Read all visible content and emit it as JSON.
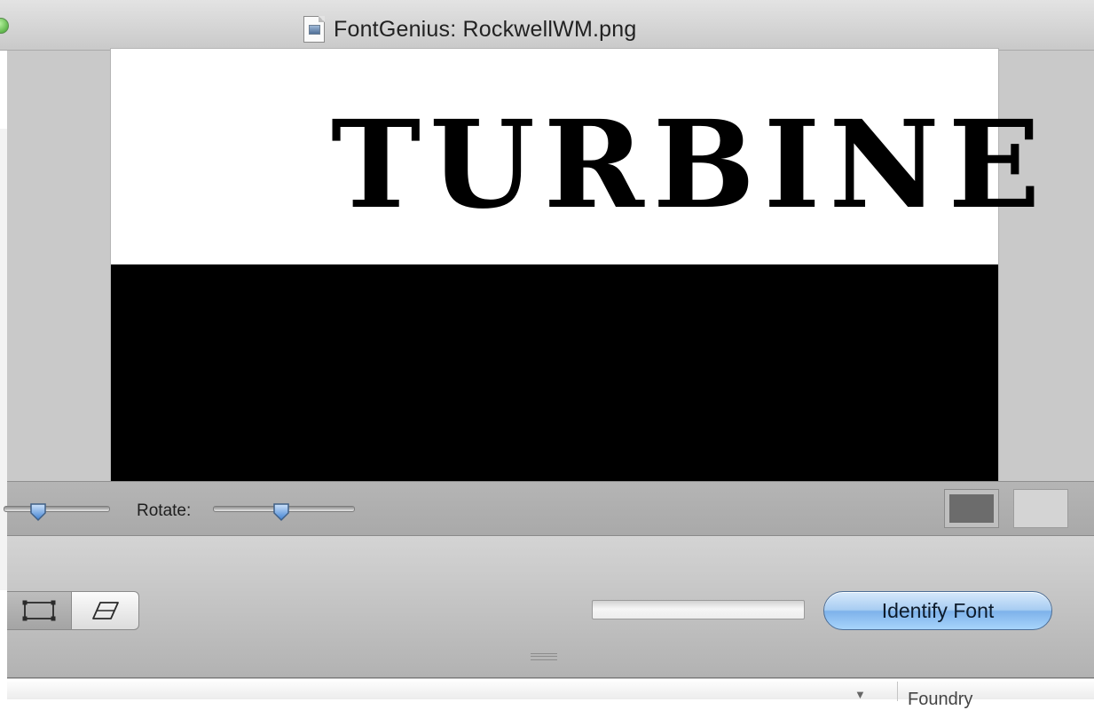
{
  "window": {
    "title": "FontGenius: RockwellWM.png"
  },
  "image": {
    "sample_text": "TURBINE"
  },
  "controls": {
    "rotate_label": "Rotate:",
    "zoom_slider_value": 0.35,
    "rotate_slider_value": 0.5
  },
  "toolbar": {
    "identify_button_label": "Identify Font",
    "progress": 0
  },
  "table": {
    "sort_indicator": "▼",
    "columns": [
      "Foundry"
    ]
  },
  "colors": {
    "accent_button": "#8fc0ef",
    "swatch_dark": "#6c6c6c",
    "swatch_light": "#d4d4d4"
  }
}
